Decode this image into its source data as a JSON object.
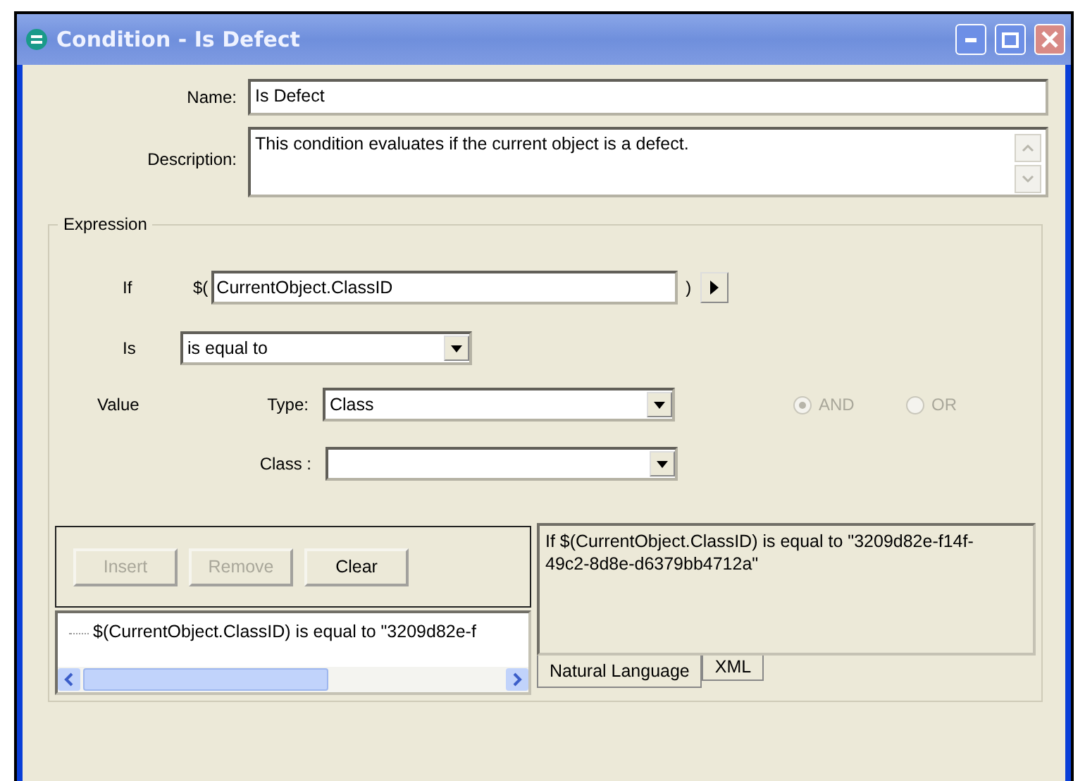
{
  "window": {
    "title": "Condition - Is Defect"
  },
  "name": {
    "label": "Name:",
    "value": "Is Defect"
  },
  "description": {
    "label": "Description:",
    "value": "This condition evaluates if the current object is a defect."
  },
  "expression": {
    "title": "Expression",
    "if": {
      "label": "If",
      "open": "$(",
      "value": "CurrentObject.ClassID",
      "close": ")"
    },
    "is": {
      "label": "Is",
      "value": "is equal to"
    },
    "value_label": "Value",
    "type": {
      "label": "Type:",
      "value": "Class"
    },
    "class": {
      "label": "Class :"
    },
    "logic": [
      {
        "label": "AND",
        "selected": true,
        "disabled": true
      },
      {
        "label": "OR",
        "selected": false,
        "disabled": true
      }
    ]
  },
  "buttons": [
    {
      "label": "Insert",
      "disabled": true
    },
    {
      "label": "Remove",
      "disabled": true
    },
    {
      "label": "Clear",
      "disabled": false
    }
  ],
  "tree": {
    "items": [
      "$(CurrentObject.ClassID) is equal to \"3209d82e-f"
    ]
  },
  "preview": {
    "text": "If $(CurrentObject.ClassID) is equal to \"3209d82e-f14f-49c2-8d8e-d6379bb4712a\""
  },
  "tabs": [
    {
      "label": "Natural Language",
      "selected": true
    },
    {
      "label": "XML",
      "selected": false
    }
  ]
}
